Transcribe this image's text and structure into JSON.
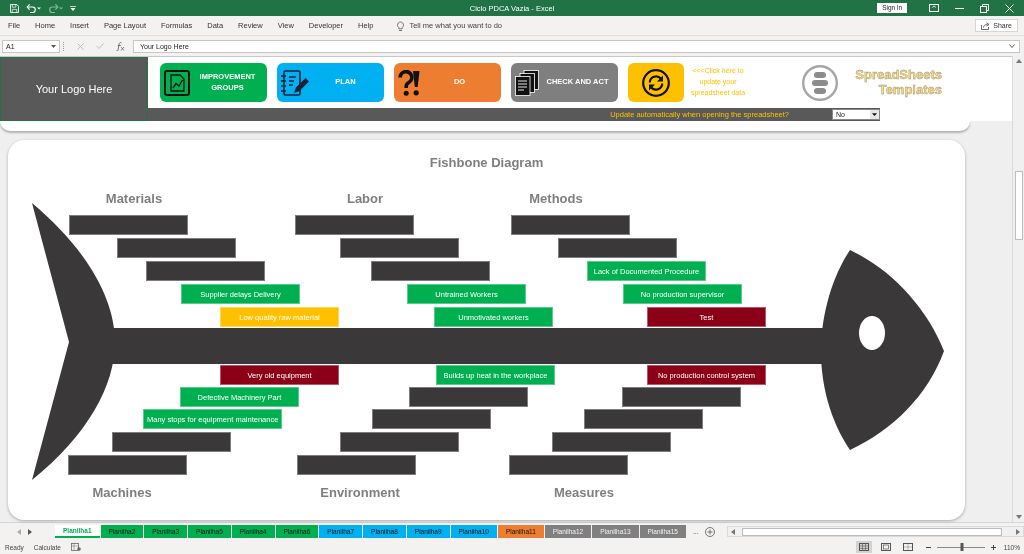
{
  "window": {
    "title": "Ciclo PDCA Vazia - Excel",
    "sign_in": "Sign in"
  },
  "quick_access": [
    {
      "kind": "save",
      "disabled": false
    },
    {
      "kind": "undo",
      "disabled": false
    },
    {
      "kind": "redo",
      "disabled": true
    }
  ],
  "ribbon": {
    "tabs": [
      "File",
      "Home",
      "Insert",
      "Page Layout",
      "Formulas",
      "Data",
      "Review",
      "View",
      "Developer",
      "Help"
    ],
    "tell_me": {
      "placeholder": "Tell me what you want to do"
    },
    "share": "Share"
  },
  "formula_bar": {
    "name_box": "A1",
    "formula": "Your Logo Here"
  },
  "header": {
    "logo": "Your Logo Here",
    "buttons": [
      {
        "kind": "chart",
        "label": "IMPROVEMENT GROUPS",
        "color": "#00b050"
      },
      {
        "kind": "notepad",
        "label": "PLAN",
        "color": "#00b0f0"
      },
      {
        "kind": "question",
        "label": "DO",
        "color": "#ed7d31"
      },
      {
        "kind": "documents",
        "label": "CHECK AND ACT",
        "color": "#7f7f7f"
      },
      {
        "kind": "refresh",
        "color": "#ffc000"
      }
    ],
    "refresh_hint": "<<<Click here to update your spreadsheet data",
    "brand": "SpreadSheets Templates",
    "auto_update": {
      "label": "Update automatically when opening the spreadsheet?",
      "value": "No"
    }
  },
  "fishbone": {
    "title": "Fishbone Diagram",
    "categories": [
      {
        "name": "Materials",
        "kind": "top",
        "causes": [
          {
            "color": "#3a3838"
          },
          {
            "color": "#3a3838"
          },
          {
            "color": "#3a3838"
          },
          {
            "color": "#00b050",
            "text": "Supplier delays Delivery"
          },
          {
            "color": "#ffc000",
            "text": "Low quality raw material"
          }
        ]
      },
      {
        "name": "Labor",
        "kind": "top",
        "causes": [
          {
            "color": "#3a3838"
          },
          {
            "color": "#3a3838"
          },
          {
            "color": "#3a3838"
          },
          {
            "color": "#00b050",
            "text": "Untrained Workers"
          },
          {
            "color": "#00b050",
            "text": "Unmotivated workers"
          }
        ]
      },
      {
        "name": "Methods",
        "kind": "top",
        "causes": [
          {
            "color": "#3a3838"
          },
          {
            "color": "#3a3838"
          },
          {
            "color": "#00b050",
            "text": "Lack of Documented Procedure"
          },
          {
            "color": "#00b050",
            "text": "No production supervisor"
          },
          {
            "color": "#8b0016",
            "text": "Test"
          }
        ]
      },
      {
        "name": "Machines",
        "kind": "bottom",
        "causes": [
          {
            "color": "#8b0016",
            "text": "Very old equipment"
          },
          {
            "color": "#00b050",
            "text": "Defective Machinery Part"
          },
          {
            "color": "#00b050",
            "text": "Many stops for equipment maintenance"
          },
          {
            "color": "#3a3838"
          },
          {
            "color": "#3a3838"
          }
        ]
      },
      {
        "name": "Environment",
        "kind": "bottom",
        "causes": [
          {
            "color": "#00b050",
            "text": "Builds up heat in the workplace"
          },
          {
            "color": "#3a3838"
          },
          {
            "color": "#3a3838"
          },
          {
            "color": "#3a3838"
          },
          {
            "color": "#3a3838"
          }
        ]
      },
      {
        "name": "Measures",
        "kind": "bottom",
        "causes": [
          {
            "color": "#8b0016",
            "text": "No production control system"
          },
          {
            "color": "#3a3838"
          },
          {
            "color": "#3a3838"
          },
          {
            "color": "#3a3838"
          },
          {
            "color": "#3a3838"
          }
        ]
      }
    ]
  },
  "sheet_tabs": {
    "tabs": [
      {
        "label": "Planilha1",
        "selected": true,
        "color": "#00b050"
      },
      {
        "label": "Planilha2",
        "selected": false,
        "color": "#00b050"
      },
      {
        "label": "Planilha3",
        "selected": false,
        "color": "#00b050"
      },
      {
        "label": "Planilha5",
        "selected": false,
        "color": "#00b050"
      },
      {
        "label": "Planilha4",
        "selected": false,
        "color": "#00b050"
      },
      {
        "label": "Planilha6",
        "selected": false,
        "color": "#00b050"
      },
      {
        "label": "Planilha7",
        "selected": false,
        "color": "#00b0f0"
      },
      {
        "label": "Planilha8",
        "selected": false,
        "color": "#00b0f0"
      },
      {
        "label": "Planilha9",
        "selected": false,
        "color": "#00b0f0"
      },
      {
        "label": "Planilha10",
        "selected": false,
        "color": "#00b0f0"
      },
      {
        "label": "Planilha11",
        "selected": false,
        "color": "#ed7d31"
      },
      {
        "label": "Planilha12",
        "selected": false,
        "color": "#808080"
      },
      {
        "label": "Planilha13",
        "selected": false,
        "color": "#808080"
      },
      {
        "label": "Planilha15",
        "selected": false,
        "color": "#808080"
      }
    ],
    "more": "..."
  },
  "status_bar": {
    "mode": "Ready",
    "calculate": "Calculate",
    "views": [
      {
        "kind": "normal",
        "selected": true
      },
      {
        "kind": "layout",
        "selected": false
      },
      {
        "kind": "pagebreak",
        "selected": false
      }
    ],
    "zoom": {
      "level": 0.52,
      "reading": "110%"
    }
  }
}
